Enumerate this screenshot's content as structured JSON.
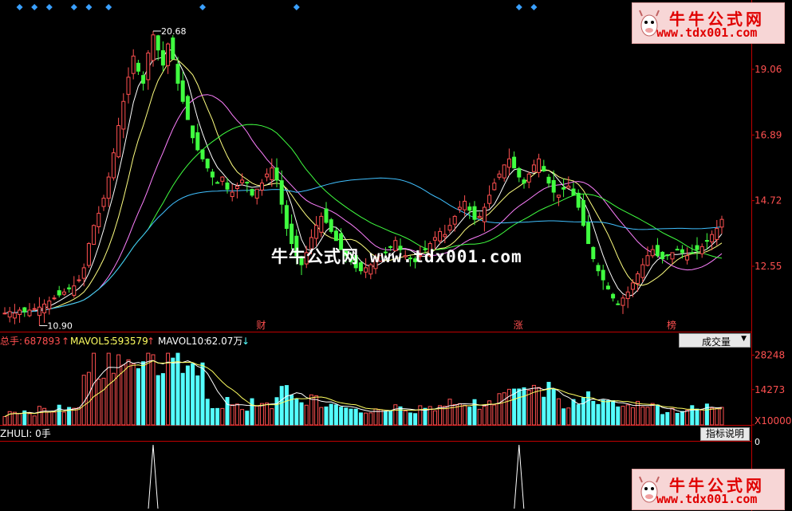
{
  "chart_data": {
    "type": "candlestick",
    "price_axis": {
      "ticks": [
        "19.06",
        "16.89",
        "14.72",
        "12.55"
      ],
      "tick_values": [
        19.06,
        16.89,
        14.72,
        12.55
      ]
    },
    "annotations": {
      "high": "20.68",
      "low": "10.90"
    },
    "event_markers": [
      {
        "label": "财",
        "index": 52
      },
      {
        "label": "涨",
        "index": 104
      },
      {
        "label": "榜",
        "index": 135
      }
    ],
    "close": [
      11.0,
      11.05,
      11.0,
      11.1,
      11.05,
      11.1,
      11.15,
      11.2,
      11.3,
      11.4,
      11.5,
      11.6,
      11.7,
      11.8,
      11.9,
      12.1,
      12.5,
      13.3,
      13.9,
      14.3,
      14.8,
      15.5,
      16.3,
      17.2,
      18.0,
      18.8,
      19.5,
      19.0,
      18.6,
      19.6,
      20.2,
      19.7,
      19.2,
      19.9,
      19.4,
      18.6,
      18.0,
      17.4,
      16.8,
      16.4,
      16.1,
      15.8,
      15.5,
      15.3,
      15.5,
      15.1,
      15.0,
      15.2,
      15.4,
      15.3,
      14.9,
      15.1,
      15.3,
      15.6,
      15.8,
      15.4,
      14.6,
      13.8,
      13.3,
      12.9,
      12.6,
      13.0,
      13.5,
      13.9,
      14.2,
      14.0,
      13.7,
      13.4,
      13.1,
      12.9,
      12.7,
      12.5,
      12.4,
      12.5,
      12.6,
      12.8,
      12.9,
      13.0,
      13.2,
      13.4,
      13.1,
      12.9,
      12.8,
      12.7,
      12.9,
      13.1,
      13.3,
      13.5,
      13.7,
      13.6,
      13.9,
      14.2,
      14.5,
      14.7,
      14.4,
      14.1,
      14.2,
      14.5,
      14.9,
      15.3,
      15.6,
      15.9,
      16.1,
      15.8,
      15.5,
      15.3,
      15.6,
      15.9,
      16.1,
      15.7,
      15.3,
      15.0,
      14.9,
      15.1,
      15.2,
      14.9,
      14.5,
      13.9,
      13.3,
      12.8,
      12.4,
      12.1,
      11.8,
      11.5,
      11.3,
      11.5,
      11.7,
      12.0,
      12.3,
      12.6,
      12.9,
      13.1,
      12.9,
      12.8,
      12.9,
      13.0,
      13.1,
      13.0,
      12.9,
      13.0,
      13.1,
      13.2,
      13.4,
      13.6,
      13.8,
      14.1
    ],
    "ma_series": [
      {
        "color": "#ffffff",
        "period": 5
      },
      {
        "color": "#ffff80",
        "period": 10
      },
      {
        "color": "#ff80ff",
        "period": 20
      },
      {
        "color": "#40ff40",
        "period": 30
      },
      {
        "color": "#40c0ff",
        "period": 60
      }
    ],
    "volume": {
      "total_label": "总手:",
      "total_value": "687893",
      "mavol5_label": "MAVOL5:",
      "mavol5_value": "593579",
      "mavol10_label": "MAVOL10:",
      "mavol10_value": "62.07万",
      "axis_ticks": [
        "28248",
        "14273",
        "X10000"
      ],
      "axis_tick_values": [
        28248,
        14273,
        0
      ],
      "selector": "成交量"
    },
    "indicator": {
      "label": "ZHULI: 0手",
      "axis_tick": "0",
      "explain_button": "指标说明",
      "spike_indices": [
        30,
        104
      ]
    }
  },
  "watermark": {
    "center": "牛牛公式网 www.tdx001.com",
    "logo_cn": "牛牛公式网",
    "logo_url": "www.tdx001.com"
  },
  "colors": {
    "up": "#ff5050",
    "down": "#54ffff",
    "down_candle": "#40ff40",
    "axis": "#c00000",
    "text_red": "#ff5050",
    "text_yellow": "#ffff60",
    "text_white": "#ffffff",
    "diamond": "#3aa0ff"
  }
}
